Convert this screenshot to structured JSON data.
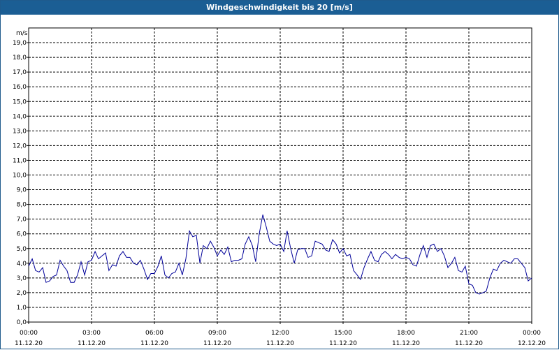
{
  "window": {
    "title": "Windgeschwindigkeit bis 20 [m/s]"
  },
  "chart_data": {
    "type": "line",
    "title": "Windgeschwindigkeit bis 20 [m/s]",
    "ylabel": "m/s",
    "xlabel": "",
    "ylim": [
      0,
      20
    ],
    "xlim": [
      0,
      24
    ],
    "grid": true,
    "line_color": "#000099",
    "y_ticks": [
      "0,0",
      "1,0",
      "2,0",
      "3,0",
      "4,0",
      "5,0",
      "6,0",
      "7,0",
      "8,0",
      "9,0",
      "10,0",
      "11,0",
      "12,0",
      "13,0",
      "14,0",
      "15,0",
      "16,0",
      "17,0",
      "18,0",
      "19,0"
    ],
    "x_ticks": [
      {
        "time": "00:00",
        "date": "11.12.20"
      },
      {
        "time": "03:00",
        "date": "11.12.20"
      },
      {
        "time": "06:00",
        "date": "11.12.20"
      },
      {
        "time": "09:00",
        "date": "11.12.20"
      },
      {
        "time": "12:00",
        "date": "11.12.20"
      },
      {
        "time": "15:00",
        "date": "11.12.20"
      },
      {
        "time": "18:00",
        "date": "11.12.20"
      },
      {
        "time": "21:00",
        "date": "11.12.20"
      },
      {
        "time": "00:00",
        "date": "12.12.20"
      }
    ],
    "series": [
      {
        "values": [
          [
            0.0,
            3.8
          ],
          [
            0.17,
            4.3
          ],
          [
            0.33,
            3.5
          ],
          [
            0.5,
            3.4
          ],
          [
            0.67,
            3.7
          ],
          [
            0.83,
            2.7
          ],
          [
            1.0,
            2.8
          ],
          [
            1.17,
            3.1
          ],
          [
            1.33,
            3.2
          ],
          [
            1.5,
            4.2
          ],
          [
            1.67,
            3.8
          ],
          [
            1.83,
            3.5
          ],
          [
            2.0,
            2.7
          ],
          [
            2.17,
            2.7
          ],
          [
            2.33,
            3.2
          ],
          [
            2.5,
            4.1
          ],
          [
            2.67,
            3.2
          ],
          [
            2.83,
            4.1
          ],
          [
            3.0,
            4.2
          ],
          [
            3.17,
            4.8
          ],
          [
            3.33,
            4.3
          ],
          [
            3.5,
            4.5
          ],
          [
            3.67,
            4.7
          ],
          [
            3.83,
            3.5
          ],
          [
            4.0,
            3.9
          ],
          [
            4.17,
            3.8
          ],
          [
            4.33,
            4.5
          ],
          [
            4.5,
            4.8
          ],
          [
            4.67,
            4.4
          ],
          [
            4.83,
            4.4
          ],
          [
            5.0,
            4.0
          ],
          [
            5.17,
            3.9
          ],
          [
            5.33,
            4.2
          ],
          [
            5.5,
            3.6
          ],
          [
            5.67,
            2.9
          ],
          [
            5.83,
            3.3
          ],
          [
            6.0,
            3.3
          ],
          [
            6.17,
            3.8
          ],
          [
            6.33,
            4.5
          ],
          [
            6.5,
            3.2
          ],
          [
            6.67,
            3.0
          ],
          [
            6.83,
            3.3
          ],
          [
            7.0,
            3.4
          ],
          [
            7.17,
            4.0
          ],
          [
            7.33,
            3.2
          ],
          [
            7.5,
            4.3
          ],
          [
            7.67,
            6.2
          ],
          [
            7.83,
            5.8
          ],
          [
            8.0,
            5.9
          ],
          [
            8.17,
            4.0
          ],
          [
            8.33,
            5.2
          ],
          [
            8.5,
            5.0
          ],
          [
            8.67,
            5.5
          ],
          [
            8.83,
            5.1
          ],
          [
            9.0,
            4.5
          ],
          [
            9.17,
            4.9
          ],
          [
            9.33,
            4.6
          ],
          [
            9.5,
            5.1
          ],
          [
            9.67,
            4.1
          ],
          [
            9.83,
            4.2
          ],
          [
            10.0,
            4.2
          ],
          [
            10.17,
            4.3
          ],
          [
            10.33,
            5.3
          ],
          [
            10.5,
            5.8
          ],
          [
            10.67,
            5.2
          ],
          [
            10.83,
            4.1
          ],
          [
            11.0,
            6.0
          ],
          [
            11.17,
            7.3
          ],
          [
            11.33,
            6.5
          ],
          [
            11.5,
            5.5
          ],
          [
            11.67,
            5.3
          ],
          [
            11.83,
            5.2
          ],
          [
            12.0,
            5.3
          ],
          [
            12.17,
            4.8
          ],
          [
            12.33,
            6.2
          ],
          [
            12.5,
            5.0
          ],
          [
            12.67,
            4.0
          ],
          [
            12.83,
            4.9
          ],
          [
            13.0,
            5.0
          ],
          [
            13.17,
            5.0
          ],
          [
            13.33,
            4.4
          ],
          [
            13.5,
            4.5
          ],
          [
            13.67,
            5.5
          ],
          [
            13.83,
            5.4
          ],
          [
            14.0,
            5.3
          ],
          [
            14.17,
            4.9
          ],
          [
            14.33,
            4.8
          ],
          [
            14.5,
            5.6
          ],
          [
            14.67,
            5.3
          ],
          [
            14.83,
            4.7
          ],
          [
            15.0,
            5.0
          ],
          [
            15.17,
            4.5
          ],
          [
            15.33,
            4.6
          ],
          [
            15.5,
            3.5
          ],
          [
            15.67,
            3.2
          ],
          [
            15.83,
            2.9
          ],
          [
            16.0,
            3.7
          ],
          [
            16.17,
            4.3
          ],
          [
            16.33,
            4.8
          ],
          [
            16.5,
            4.2
          ],
          [
            16.67,
            4.1
          ],
          [
            16.83,
            4.6
          ],
          [
            17.0,
            4.8
          ],
          [
            17.17,
            4.6
          ],
          [
            17.33,
            4.3
          ],
          [
            17.5,
            4.6
          ],
          [
            17.67,
            4.4
          ],
          [
            17.83,
            4.3
          ],
          [
            18.0,
            4.4
          ],
          [
            18.17,
            4.3
          ],
          [
            18.33,
            3.9
          ],
          [
            18.5,
            3.8
          ],
          [
            18.67,
            4.6
          ],
          [
            18.83,
            5.2
          ],
          [
            19.0,
            4.4
          ],
          [
            19.17,
            5.2
          ],
          [
            19.33,
            5.3
          ],
          [
            19.5,
            4.8
          ],
          [
            19.67,
            5.0
          ],
          [
            19.83,
            4.5
          ],
          [
            20.0,
            3.7
          ],
          [
            20.17,
            4.0
          ],
          [
            20.33,
            4.4
          ],
          [
            20.5,
            3.5
          ],
          [
            20.67,
            3.4
          ],
          [
            20.83,
            3.8
          ],
          [
            21.0,
            2.6
          ],
          [
            21.17,
            2.5
          ],
          [
            21.33,
            2.0
          ],
          [
            21.5,
            1.9
          ],
          [
            21.67,
            2.0
          ],
          [
            21.83,
            2.1
          ],
          [
            22.0,
            3.0
          ],
          [
            22.17,
            3.6
          ],
          [
            22.33,
            3.5
          ],
          [
            22.5,
            4.0
          ],
          [
            22.67,
            4.2
          ],
          [
            22.83,
            4.1
          ],
          [
            23.0,
            4.0
          ],
          [
            23.17,
            4.3
          ],
          [
            23.33,
            4.3
          ],
          [
            23.5,
            4.0
          ],
          [
            23.67,
            3.7
          ],
          [
            23.83,
            2.8
          ],
          [
            24.0,
            3.0
          ]
        ]
      }
    ]
  }
}
